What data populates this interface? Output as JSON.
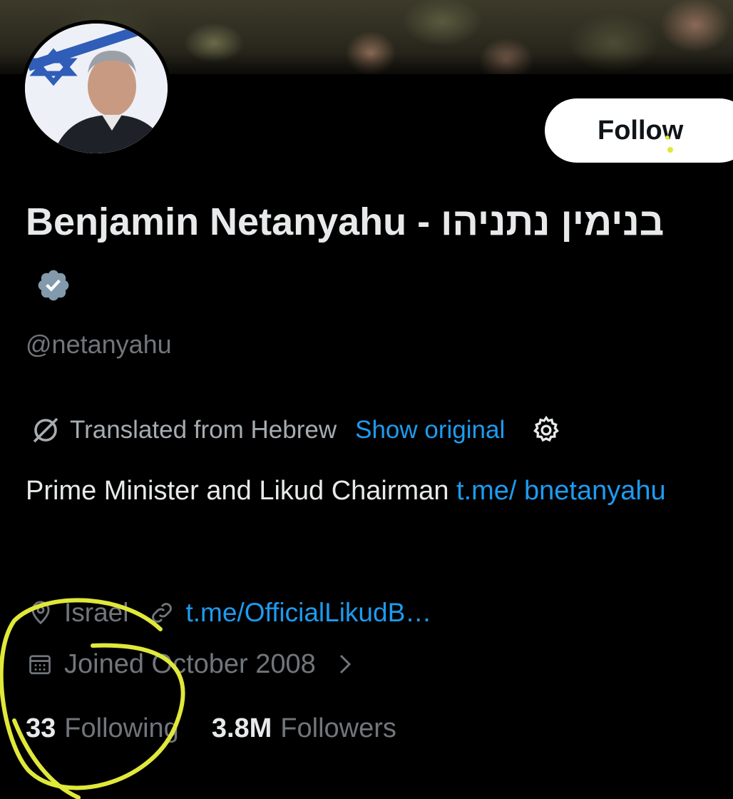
{
  "profile": {
    "name": "Benjamin Netanyahu - בנימין נתניהו",
    "handle": "@netanyahu",
    "follow_label": "Follow"
  },
  "translation": {
    "label": "Translated from Hebrew",
    "show_original": "Show original"
  },
  "bio": {
    "text": "Prime Minister and Likud Chairman ",
    "link": "t.me/ bnetanyahu"
  },
  "meta": {
    "location": "Israel",
    "website": "t.me/OfficialLikudB…",
    "joined": "Joined October 2008"
  },
  "stats": {
    "following_count": "33",
    "following_label": "Following",
    "followers_count": "3.8M",
    "followers_label": "Followers"
  },
  "colors": {
    "background": "#000000",
    "accent": "#1d9bf0",
    "verified": "#829aab",
    "annotation": "#e0e83a"
  }
}
